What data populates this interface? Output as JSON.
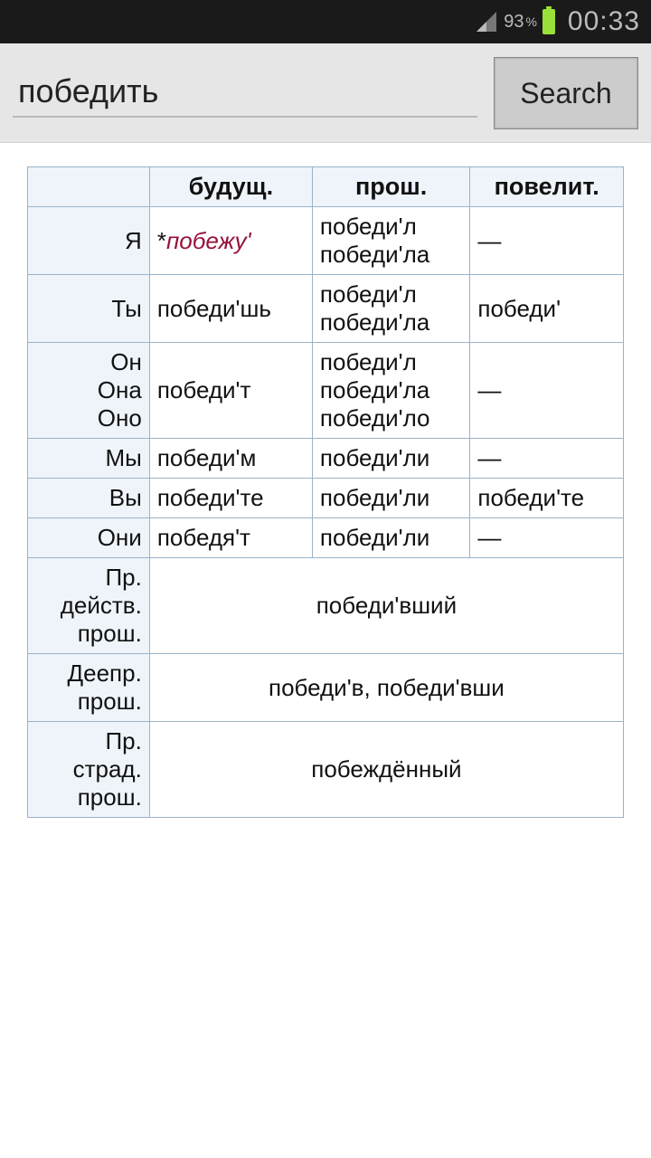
{
  "status": {
    "battery_pct": "93",
    "time": "00:33"
  },
  "search": {
    "value": "победить",
    "button": "Search"
  },
  "table": {
    "headers": {
      "c0": "",
      "c1": "будущ.",
      "c2": "прош.",
      "c3": "повелит."
    },
    "rows": [
      {
        "label": "Я",
        "future": "*побежу'",
        "future_hypo": true,
        "past": "победи'л\nпобеди'ла",
        "imper": "—"
      },
      {
        "label": "Ты",
        "future": "победи'шь",
        "past": "победи'л\nпобеди'ла",
        "imper": "победи'"
      },
      {
        "label": "Он\nОна\nОно",
        "future": "победи'т",
        "past": "победи'л\nпобеди'ла\nпобеди'ло",
        "imper": "—"
      },
      {
        "label": "Мы",
        "future": "победи'м",
        "past": "победи'ли",
        "imper": "—"
      },
      {
        "label": "Вы",
        "future": "победи'те",
        "past": "победи'ли",
        "imper": "победи'те"
      },
      {
        "label": "Они",
        "future": "победя'т",
        "past": "победи'ли",
        "imper": "—"
      }
    ],
    "extra": [
      {
        "label": "Пр.\nдейств.\nпрош.",
        "value": "победи'вший"
      },
      {
        "label": "Деепр.\nпрош.",
        "value": "победи'в, победи'вши"
      },
      {
        "label": "Пр.\nстрад.\nпрош.",
        "value": "побеждённый"
      }
    ]
  }
}
